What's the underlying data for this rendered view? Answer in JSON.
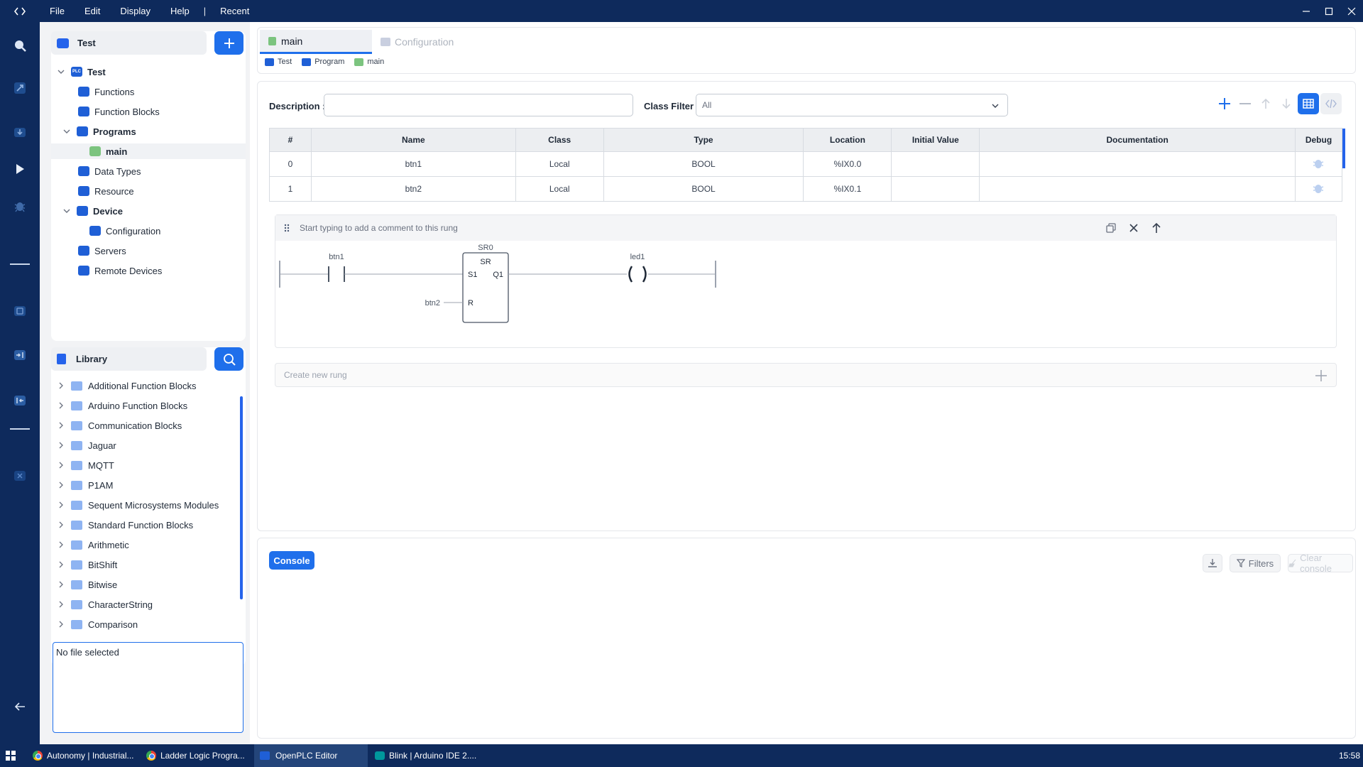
{
  "titlebar": {
    "menu": [
      "File",
      "Edit",
      "Display",
      "Help",
      "|",
      "Recent"
    ]
  },
  "project": {
    "name": "Test",
    "tree": {
      "root": "Test",
      "functions": "Functions",
      "function_blocks": "Function Blocks",
      "programs": "Programs",
      "main": "main",
      "data_types": "Data Types",
      "resource": "Resource",
      "device": "Device",
      "configuration": "Configuration",
      "servers": "Servers",
      "remote_devices": "Remote Devices"
    }
  },
  "library": {
    "title": "Library",
    "items": [
      "Additional Function Blocks",
      "Arduino Function Blocks",
      "Communication Blocks",
      "Jaguar",
      "MQTT",
      "P1AM",
      "Sequent Microsystems Modules",
      "Standard Function Blocks",
      "Arithmetic",
      "BitShift",
      "Bitwise",
      "CharacterString",
      "Comparison"
    ],
    "file_status": "No file selected"
  },
  "tabs": {
    "main": "main",
    "configuration": "Configuration"
  },
  "breadcrumb": [
    "Test",
    "Program",
    "main"
  ],
  "filters": {
    "description_label": "Description :",
    "description_value": "",
    "class_filter_label": "Class Filter :",
    "class_filter_value": "All"
  },
  "table": {
    "headers": [
      "#",
      "Name",
      "Class",
      "Type",
      "Location",
      "Initial Value",
      "Documentation",
      "Debug"
    ],
    "rows": [
      [
        "0",
        "btn1",
        "Local",
        "BOOL",
        "%IX0.0",
        "",
        ""
      ],
      [
        "1",
        "btn2",
        "Local",
        "BOOL",
        "%IX0.1",
        "",
        ""
      ]
    ]
  },
  "rung": {
    "comment_placeholder": "Start typing to add a comment to this rung",
    "contact_label": "btn1",
    "block_instance": "SR0",
    "block_type": "SR",
    "pin_s1": "S1",
    "pin_r": "R",
    "pin_q1": "Q1",
    "r_input": "btn2",
    "coil_label": "led1"
  },
  "new_rung": "Create new rung",
  "console": {
    "tab": "Console",
    "filters": "Filters",
    "clear": "Clear console"
  },
  "taskbar": {
    "tasks": [
      "Autonomy | Industrial...",
      "Ladder Logic Progra...",
      "OpenPLC Editor",
      "Blink | Arduino IDE 2...."
    ],
    "clock": "15:58"
  },
  "colors": {
    "navy": "#0e2a5c",
    "accent": "#1f6feb"
  }
}
